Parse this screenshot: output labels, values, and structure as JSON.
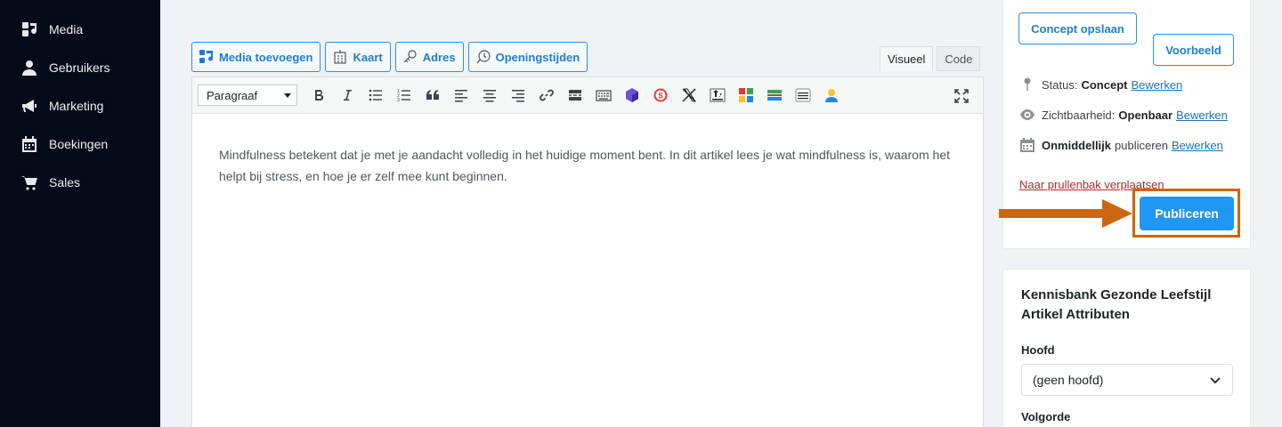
{
  "sidebar": {
    "items": [
      {
        "label": "Media",
        "icon": "media-icon"
      },
      {
        "label": "Gebruikers",
        "icon": "user-icon"
      },
      {
        "label": "Marketing",
        "icon": "megaphone-icon"
      },
      {
        "label": "Boekingen",
        "icon": "calendar-icon"
      },
      {
        "label": "Sales",
        "icon": "cart-icon"
      }
    ]
  },
  "editor": {
    "media_buttons": [
      {
        "label": "Media toevoegen",
        "icon": "media-add-icon"
      },
      {
        "label": "Kaart",
        "icon": "map-icon"
      },
      {
        "label": "Adres",
        "icon": "address-icon"
      },
      {
        "label": "Openingstijden",
        "icon": "clock-icon"
      }
    ],
    "tabs": {
      "visual": "Visueel",
      "code": "Code"
    },
    "format_select": "Paragraaf",
    "content": "Mindfulness betekent dat je met je aandacht volledig in het huidige moment bent. In dit artikel lees je wat mindfulness is, waarom het helpt bij stress, en hoe je er zelf mee kunt beginnen."
  },
  "publish_box": {
    "save_draft": "Concept opslaan",
    "preview": "Voorbeeld",
    "status_label": "Status:",
    "status_value": "Concept",
    "visibility_label": "Zichtbaarheid:",
    "visibility_value": "Openbaar",
    "schedule_value": "Onmiddellijk",
    "schedule_label": "publiceren",
    "edit_link": "Bewerken",
    "trash": "Naar prullenbak verplaatsen",
    "publish": "Publiceren"
  },
  "attributes_box": {
    "title": "Kennisbank Gezonde Leefstijl Artikel Attributen",
    "parent_label": "Hoofd",
    "parent_value": "(geen hoofd)",
    "order_label": "Volgorde"
  },
  "colors": {
    "accent": "#2196f3",
    "highlight": "#cc6611",
    "sidebar_bg": "#050a18"
  }
}
